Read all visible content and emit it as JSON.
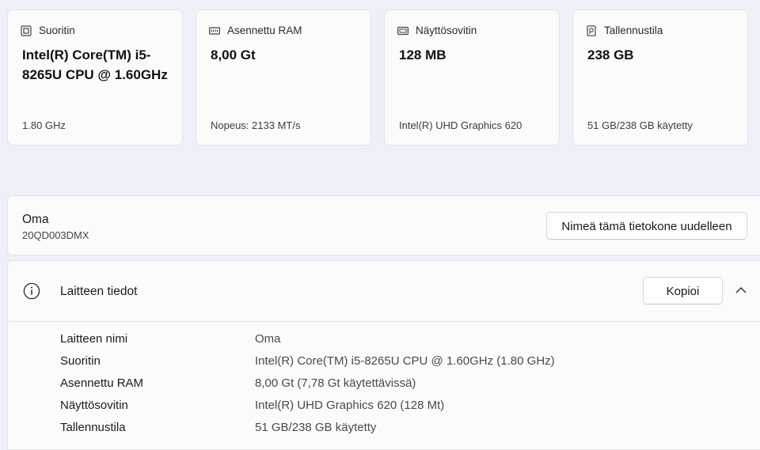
{
  "cards": [
    {
      "icon": "processor-icon",
      "label": "Suoritin",
      "value": "Intel(R) Core(TM) i5-8265U CPU @ 1.60GHz",
      "sub": "1.80 GHz"
    },
    {
      "icon": "ram-icon",
      "label": "Asennettu RAM",
      "value": "8,00 Gt",
      "sub": "Nopeus: 2133 MT/s"
    },
    {
      "icon": "display-adapter-icon",
      "label": "Näyttösovitin",
      "value": "128 MB",
      "sub": "Intel(R) UHD Graphics 620"
    },
    {
      "icon": "storage-icon",
      "label": "Tallennustila",
      "value": "238 GB",
      "sub": "51 GB/238 GB käytetty"
    }
  ],
  "device": {
    "name": "Oma",
    "model": "20QD003DMX",
    "rename_label": "Nimeä tämä tietokone uudelleen"
  },
  "device_details": {
    "title": "Laitteen tiedot",
    "copy_label": "Kopioi",
    "rows": [
      {
        "key": "Laitteen nimi",
        "value": "Oma"
      },
      {
        "key": "Suoritin",
        "value": "Intel(R) Core(TM) i5-8265U CPU @ 1.60GHz (1.80 GHz)"
      },
      {
        "key": "Asennettu RAM",
        "value": "8,00 Gt (7,78 Gt käytettävissä)"
      },
      {
        "key": "Näyttösovitin",
        "value": "Intel(R) UHD Graphics 620 (128 Mt)"
      },
      {
        "key": "Tallennustila",
        "value": "51 GB/238 GB käytetty"
      }
    ]
  }
}
